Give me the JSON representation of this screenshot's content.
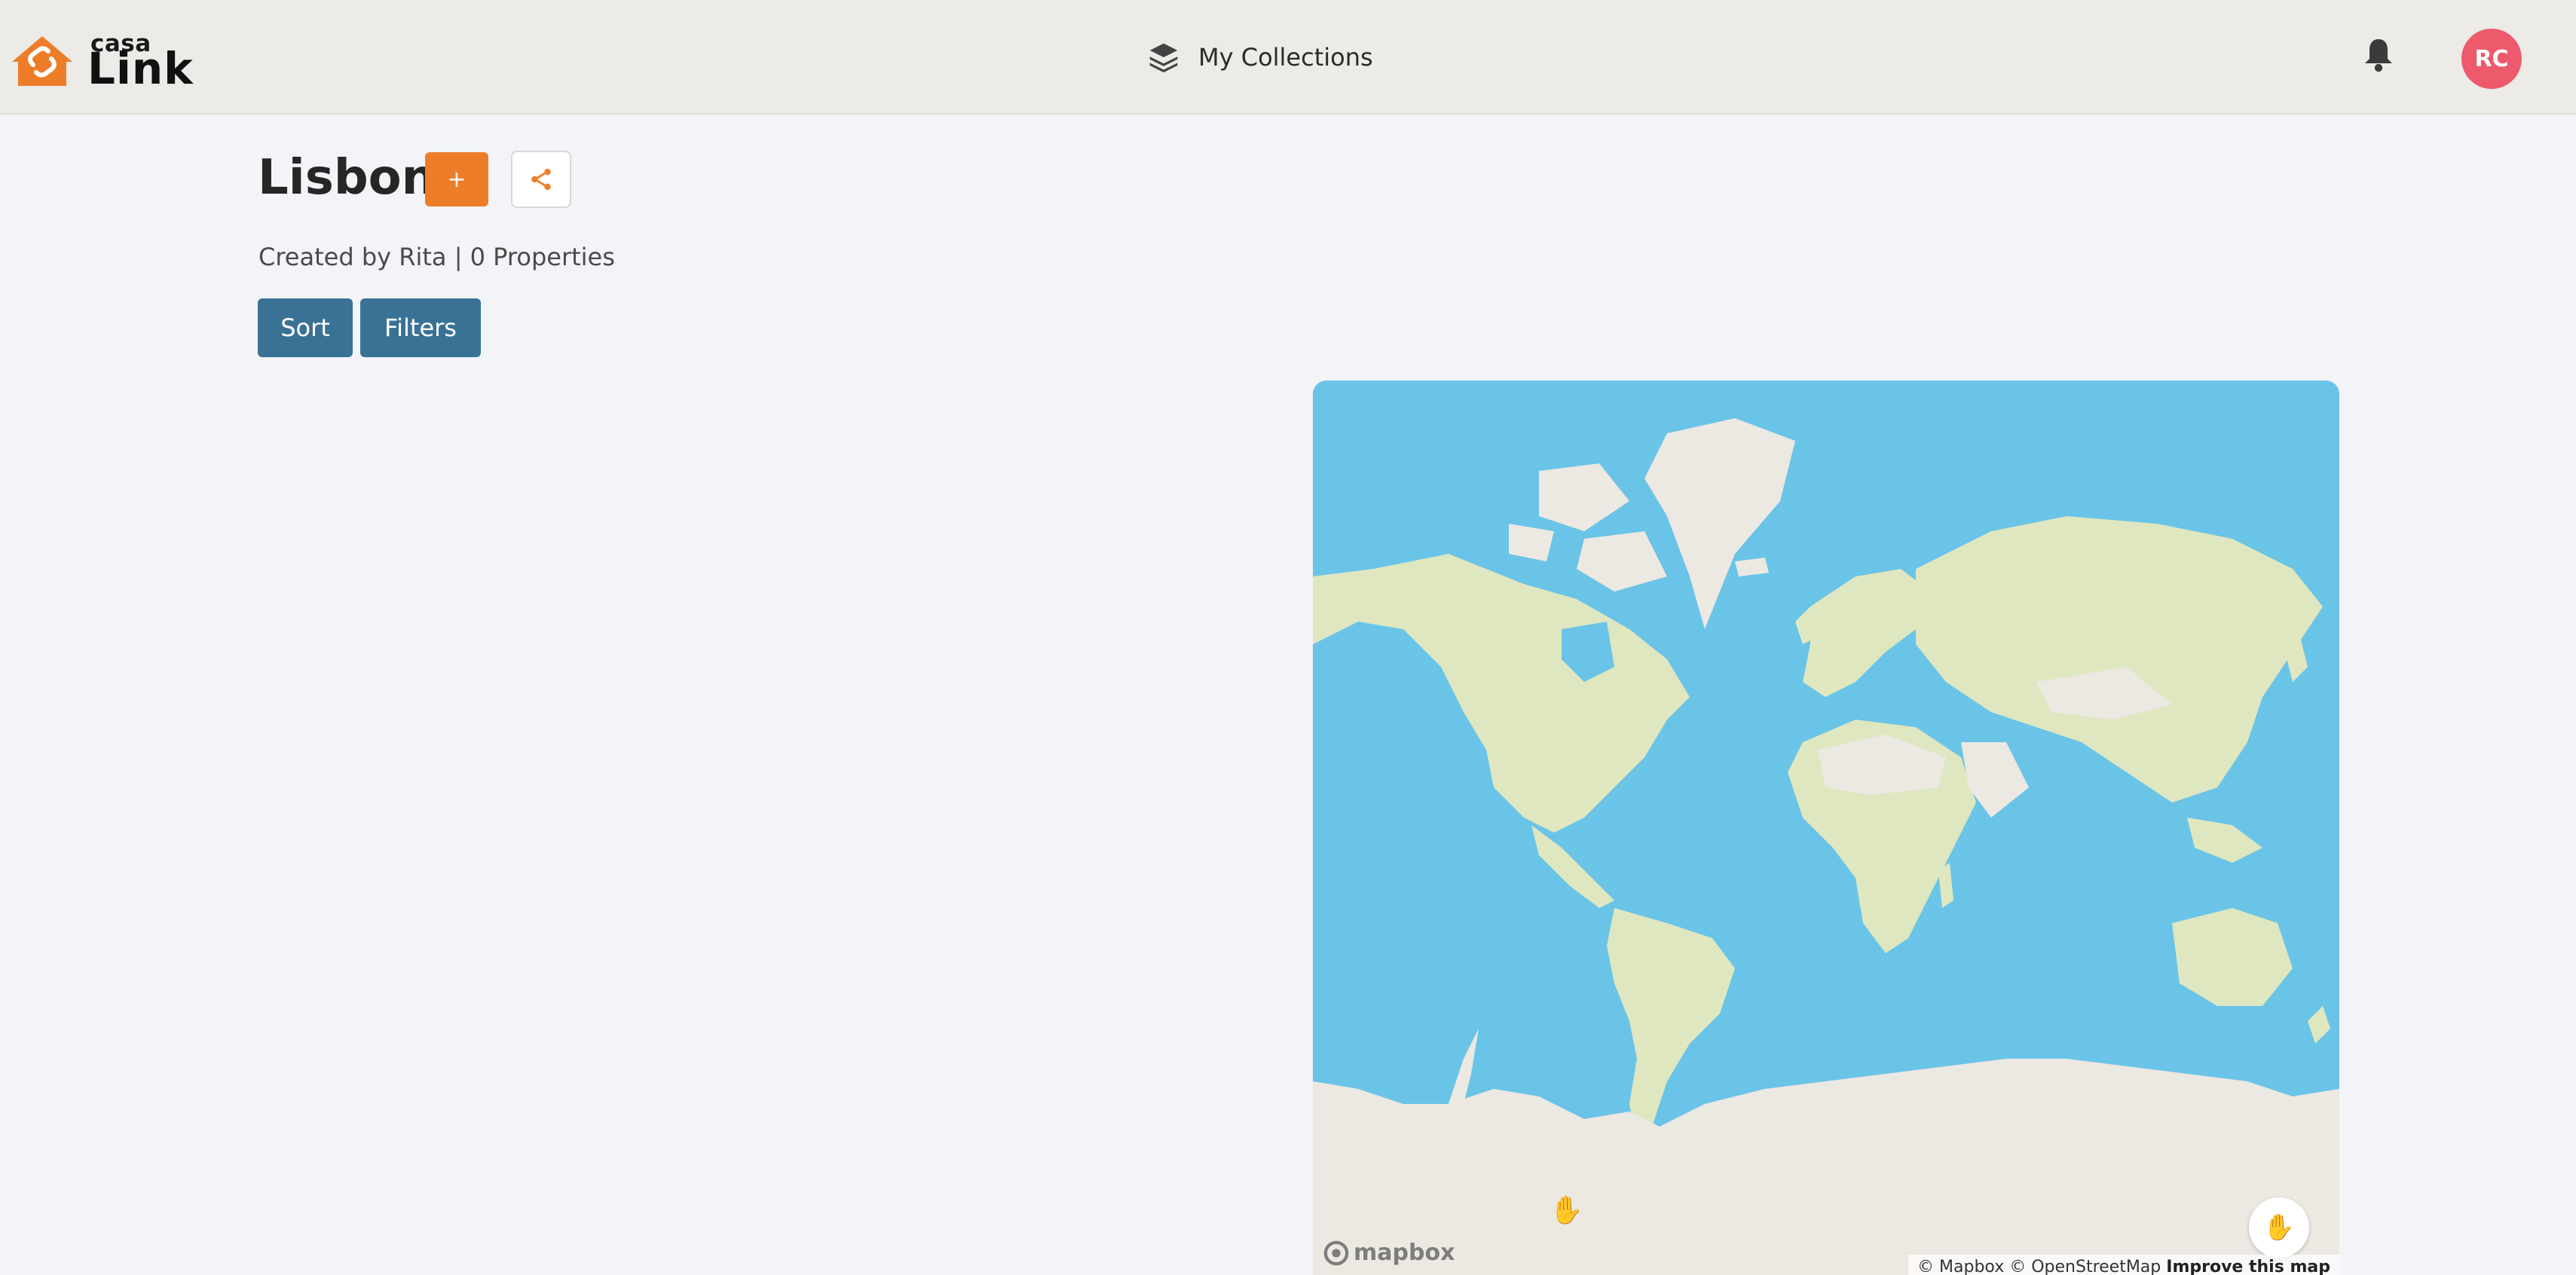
{
  "brand": {
    "small": "casa",
    "large": "Link",
    "accent": "#ee7d2a"
  },
  "nav": {
    "collections_label": "My Collections",
    "collections_icon": "layers-icon"
  },
  "header": {
    "bell_icon": "bell-icon",
    "avatar_initials": "RC",
    "avatar_color": "#ec5a6c"
  },
  "collection": {
    "title": "Lisbon",
    "add_label": "+",
    "share_icon": "share-icon",
    "meta": "Created by Rita | 0 Properties"
  },
  "toolbar": {
    "sort_label": "Sort",
    "filters_label": "Filters"
  },
  "map": {
    "provider_logo": "mapbox",
    "attribution": "© Mapbox © OpenStreetMap",
    "improve_link": "Improve this map",
    "water_color": "#6ac4e7",
    "land_color": "#dfe7c0",
    "ice_color": "#ece8e2"
  }
}
